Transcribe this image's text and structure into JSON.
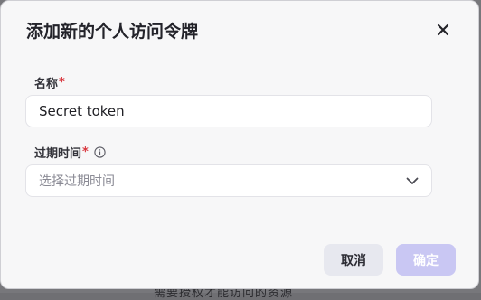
{
  "background": {
    "partial_text": "需要授权才能访问的资源"
  },
  "dialog": {
    "title": "添加新的个人访问令牌",
    "close_icon": "close-icon",
    "name_field": {
      "label": "名称",
      "required_mark": "*",
      "value": "Secret token"
    },
    "expiry_field": {
      "label": "过期时间",
      "required_mark": "*",
      "info_icon": "info-icon",
      "placeholder": "选择过期时间",
      "chevron_icon": "chevron-down-icon"
    },
    "buttons": {
      "cancel_label": "取消",
      "confirm_label": "确定"
    }
  },
  "colors": {
    "primary_disabled": "#c9c7f3",
    "required": "#d9363e",
    "cancel_bg": "#e7e8ef"
  }
}
